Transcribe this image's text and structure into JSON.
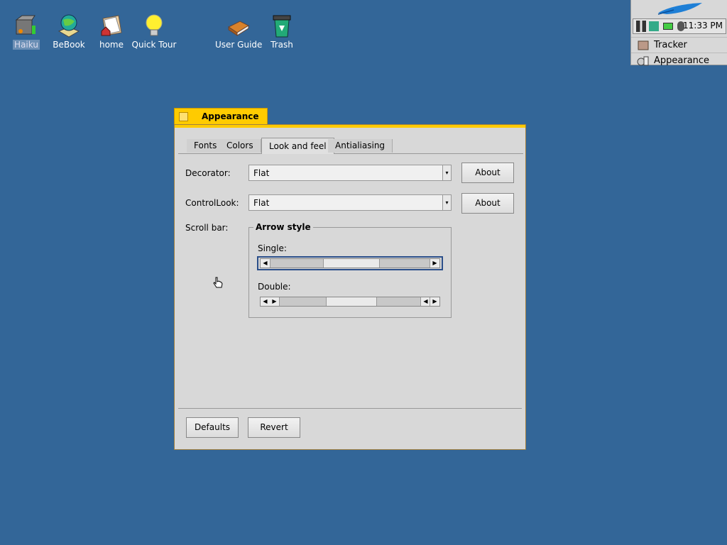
{
  "desktop": {
    "icons": [
      {
        "label": "Haiku",
        "icon": "drive-icon",
        "selected": true
      },
      {
        "label": "BeBook",
        "icon": "globe-book-icon"
      },
      {
        "label": "home",
        "icon": "home-folder-icon"
      },
      {
        "label": "Quick Tour",
        "icon": "lightbulb-icon"
      },
      {
        "label": "User Guide",
        "icon": "book-icon"
      },
      {
        "label": "Trash",
        "icon": "trash-icon"
      }
    ]
  },
  "deskbar": {
    "clock": "11:33 PM",
    "items": [
      {
        "label": "Tracker",
        "icon": "tracker-icon"
      },
      {
        "label": "Appearance",
        "icon": "appearance-icon"
      }
    ]
  },
  "window": {
    "title": "Appearance",
    "accent": "#ffcb00",
    "tabs": [
      {
        "label": "Fonts"
      },
      {
        "label": "Colors"
      },
      {
        "label": "Look and feel",
        "active": true
      },
      {
        "label": "Antialiasing"
      }
    ],
    "decorator": {
      "label": "Decorator:",
      "value": "Flat",
      "about": "About"
    },
    "controllook": {
      "label": "ControlLook:",
      "value": "Flat",
      "about": "About"
    },
    "scrollbar": {
      "label": "Scroll bar:",
      "group_title": "Arrow style",
      "single_label": "Single:",
      "double_label": "Double:"
    },
    "buttons": {
      "defaults": "Defaults",
      "revert": "Revert"
    }
  }
}
